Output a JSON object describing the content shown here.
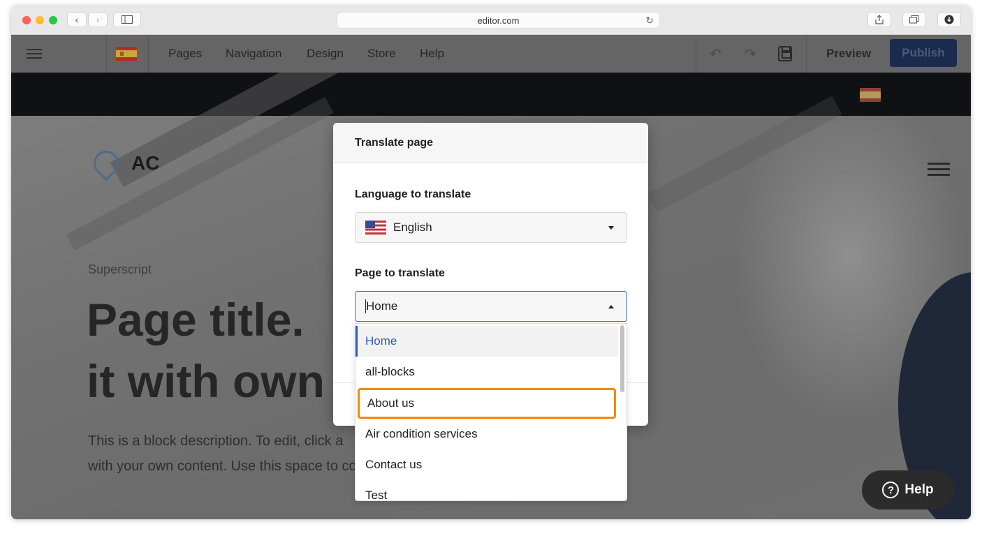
{
  "browser": {
    "url": "editor.com"
  },
  "editor_bar": {
    "nav": [
      "Pages",
      "Navigation",
      "Design",
      "Store",
      "Help"
    ],
    "preview_label": "Preview",
    "publish_label": "Publish"
  },
  "site": {
    "logo_text": "AC",
    "superscript": "Superscript",
    "title_line1": "Page title.",
    "title_line2": "it with own",
    "desc_line1": "This is a block description. To edit, click a",
    "desc_line2": "with your own content. Use this space to convert site visitors into"
  },
  "help_button": {
    "label": "Help"
  },
  "modal": {
    "title": "Translate page",
    "language_label": "Language to translate",
    "language_value": "English",
    "page_label": "Page to translate",
    "page_value": "Home"
  },
  "dropdown": {
    "options": [
      "Home",
      "all-blocks",
      "About us",
      "Air condition services",
      "Contact us",
      "Test"
    ],
    "selected": "Home",
    "highlighted": "About us"
  },
  "colors": {
    "publish": "#1b2b4d",
    "selected_option": "#2b5bb8",
    "highlight_outline": "#f08a00"
  }
}
